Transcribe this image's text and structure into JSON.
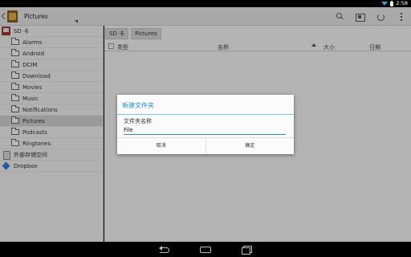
{
  "status_bar": {
    "time": "2:58"
  },
  "action_bar": {
    "title": "Pictures"
  },
  "sidebar": {
    "items": [
      {
        "label": "SD 卡",
        "icon": "sd-card-icon",
        "level": "root"
      },
      {
        "label": "Alarms",
        "icon": "folder-icon",
        "level": "child"
      },
      {
        "label": "Android",
        "icon": "folder-icon",
        "level": "child"
      },
      {
        "label": "DCIM",
        "icon": "folder-icon",
        "level": "child"
      },
      {
        "label": "Download",
        "icon": "folder-icon",
        "level": "child"
      },
      {
        "label": "Movies",
        "icon": "folder-icon",
        "level": "child"
      },
      {
        "label": "Music",
        "icon": "folder-icon",
        "level": "child"
      },
      {
        "label": "Notifications",
        "icon": "folder-icon",
        "level": "child"
      },
      {
        "label": "Pictures",
        "icon": "folder-icon",
        "level": "child",
        "selected": true
      },
      {
        "label": "Podcasts",
        "icon": "folder-icon",
        "level": "child"
      },
      {
        "label": "Ringtones",
        "icon": "folder-icon",
        "level": "child"
      },
      {
        "label": "外部存储空间",
        "icon": "external-storage-icon",
        "level": "root"
      },
      {
        "label": "Dropbox",
        "icon": "dropbox-icon",
        "level": "root"
      }
    ]
  },
  "breadcrumb": [
    "SD 卡",
    "Pictures"
  ],
  "columns": {
    "type": "类型",
    "name": "名称",
    "size": "大小",
    "date": "日期"
  },
  "dialog": {
    "title": "新建文件夹",
    "label": "文件夹名称",
    "input_value": "File",
    "cancel_label": "取消",
    "ok_label": "确定"
  },
  "colors": {
    "accent": "#2a8ccf",
    "rule": "#7bc2ea"
  }
}
